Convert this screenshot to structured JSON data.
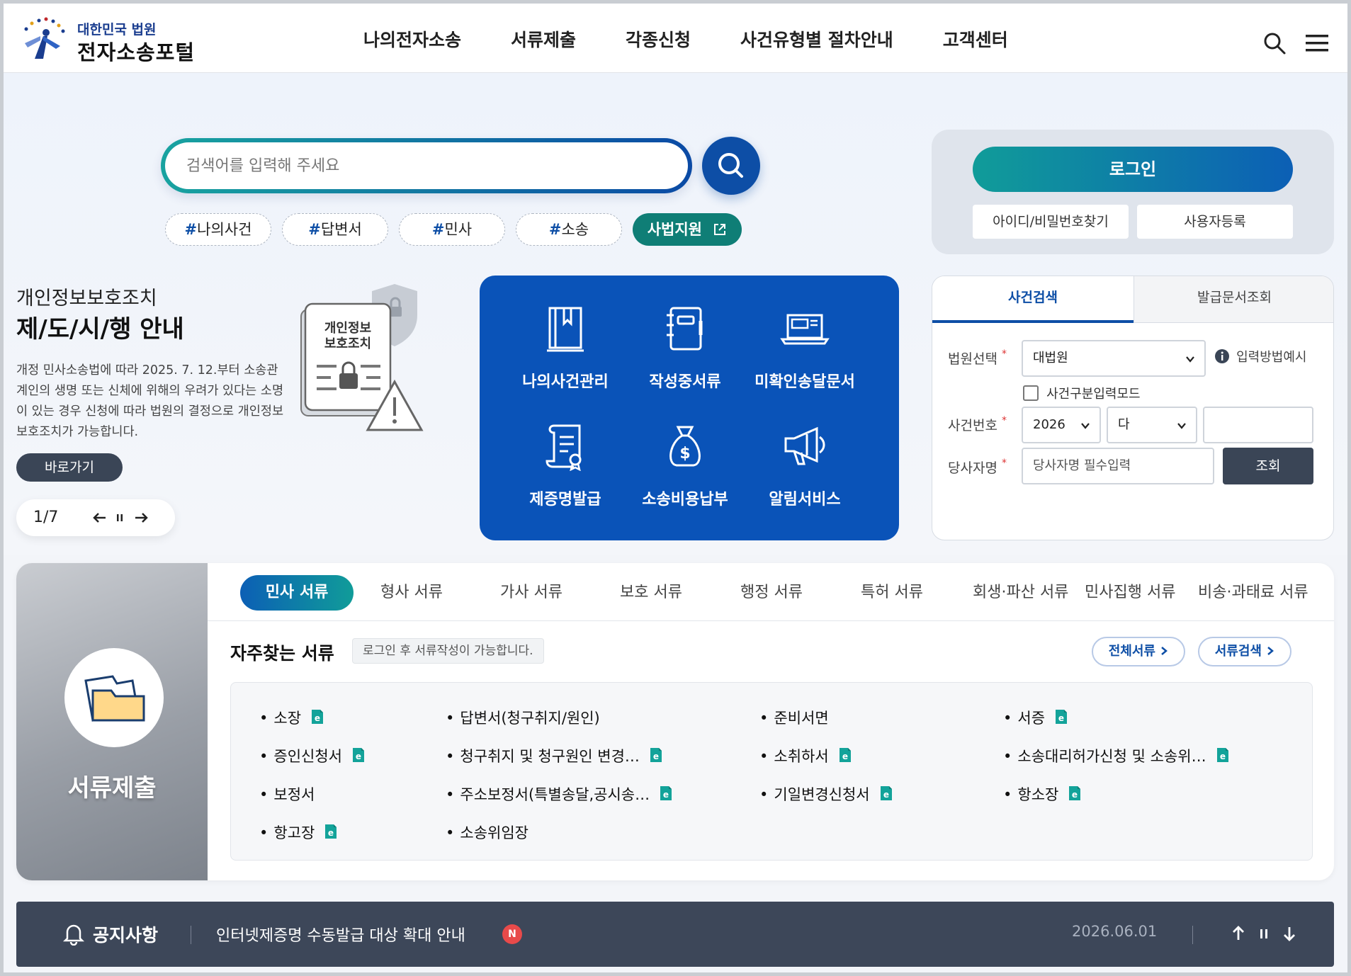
{
  "logo": {
    "sub": "대한민국 법원",
    "main": "전자소송포털"
  },
  "gnb": [
    "나의전자소송",
    "서류제출",
    "각종신청",
    "사건유형별 절차안내",
    "고객센터"
  ],
  "header_icons": [
    "search-icon",
    "menu-icon"
  ],
  "search": {
    "placeholder": "검색어를 입력해 주세요"
  },
  "tags": [
    {
      "hash": "#",
      "label": "나의사건"
    },
    {
      "hash": "#",
      "label": "답변서"
    },
    {
      "hash": "#",
      "label": "민사"
    },
    {
      "hash": "#",
      "label": "소송"
    }
  ],
  "support_button": "사법지원",
  "login": {
    "button": "로그인",
    "find": "아이디/비밀번호찾기",
    "register": "사용자등록"
  },
  "banner": {
    "subtitle": "개인정보보호조치",
    "title": "제/도/시/행 안내",
    "description": "개정 민사소송법에 따라 2025. 7. 12.부터 소송관계인의 생명 또는 신체에 위해의 우려가 있다는 소명이 있는 경우 신청에 따라 법원의 결정으로 개인정보 보호조치가 가능합니다.",
    "illustration_text_1": "개인정보",
    "illustration_text_2": "보호조치",
    "goto": "바로가기",
    "pager": "1/7"
  },
  "quick_menu": [
    {
      "label": "나의사건관리",
      "icon": "book-icon"
    },
    {
      "label": "작성중서류",
      "icon": "notebook-icon"
    },
    {
      "label": "미확인송달문서",
      "icon": "laptop-icon"
    },
    {
      "label": "제증명발급",
      "icon": "certificate-icon"
    },
    {
      "label": "소송비용납부",
      "icon": "money-bag-icon"
    },
    {
      "label": "알림서비스",
      "icon": "megaphone-icon"
    }
  ],
  "case_search": {
    "tab_active": "사건검색",
    "tab_inactive": "발급문서조회",
    "court_label": "법원선택",
    "court_value": "대법원",
    "help": "입력방법예시",
    "mode_checkbox": "사건구분입력모드",
    "case_no_label": "사건번호",
    "year_value": "2026",
    "type_value": "다",
    "party_label": "당사자명",
    "party_placeholder": "당사자명 필수입력",
    "inquiry": "조회",
    "required_mark": "*"
  },
  "docs": {
    "side_title": "서류제출",
    "tabs": [
      "민사 서류",
      "형사 서류",
      "가사 서류",
      "보호 서류",
      "행정 서류",
      "특허 서류",
      "회생·파산 서류",
      "민사집행 서류",
      "비송·과태료 서류"
    ],
    "freq_title": "자주찾는 서류",
    "freq_note": "로그인 후 서류작성이 가능합니다.",
    "all_docs": "전체서류",
    "search_docs": "서류검색",
    "items": [
      {
        "label": "소장",
        "e": true
      },
      {
        "label": "답변서(청구취지/원인)",
        "e": false
      },
      {
        "label": "준비서면",
        "e": false
      },
      {
        "label": "서증",
        "e": true
      },
      {
        "label": "증인신청서",
        "e": true
      },
      {
        "label": "청구취지 및 청구원인 변경…",
        "e": true
      },
      {
        "label": "소취하서",
        "e": true
      },
      {
        "label": "소송대리허가신청 및 소송위…",
        "e": true
      },
      {
        "label": "보정서",
        "e": false
      },
      {
        "label": "주소보정서(특별송달,공시송…",
        "e": true
      },
      {
        "label": "기일변경신청서",
        "e": true
      },
      {
        "label": "항소장",
        "e": true
      },
      {
        "label": "항고장",
        "e": true
      },
      {
        "label": "소송위임장",
        "e": false
      }
    ]
  },
  "noticebar": {
    "label": "공지사항",
    "text": "인터넷제증명 수동발급 대상 확대 안내",
    "badge": "N",
    "date": "2026.06.01"
  },
  "colors": {
    "primary": "#0d4ea6",
    "teal": "#0f7e76",
    "quick_bg": "#0a53b8",
    "dark": "#3a4556",
    "notice_bg": "#3d4759"
  }
}
